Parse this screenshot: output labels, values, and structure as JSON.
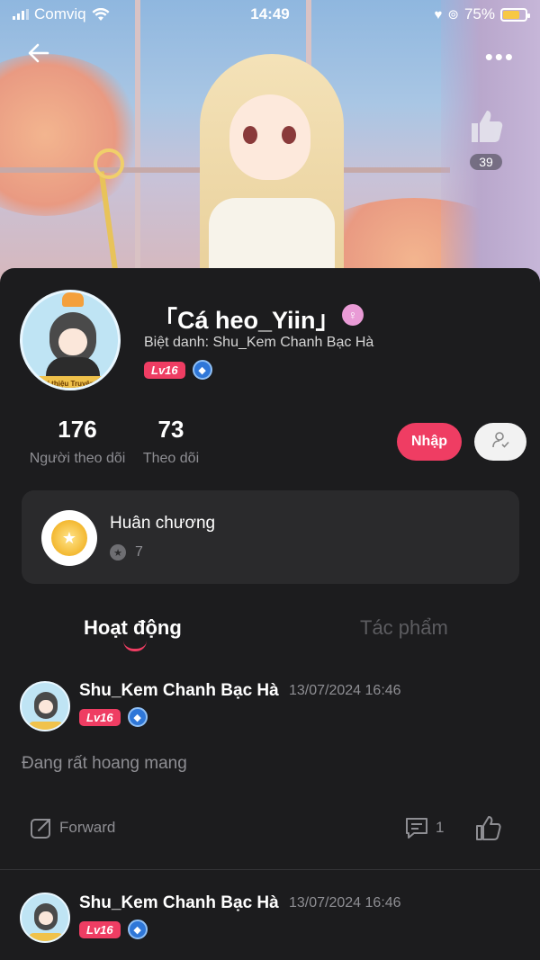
{
  "status_bar": {
    "carrier": "Comviq",
    "time": "14:49",
    "battery": "75%",
    "battery_level": 0.75
  },
  "header": {
    "like_count": "39"
  },
  "profile": {
    "name": "「Cá heo_Yiin」",
    "nickname": "Biệt danh: Shu_Kem Chanh Bạc Hà",
    "level": "Lv16",
    "avatar_caption": "Giới thiệu Truyện chat",
    "followers": {
      "count": "176",
      "label": "Người theo dõi"
    },
    "following": {
      "count": "73",
      "label": "Theo dõi"
    },
    "join_label": "Nhập"
  },
  "medal": {
    "title": "Huân chương",
    "count": "7"
  },
  "tabs": [
    {
      "label": "Hoạt động",
      "active": true
    },
    {
      "label": "Tác phẩm",
      "active": false
    }
  ],
  "posts": [
    {
      "author": "Shu_Kem Chanh Bạc Hà",
      "time": "13/07/2024 16:46",
      "level": "Lv16",
      "text": "Đang rất hoang mang",
      "forward_label": "Forward",
      "comment_count": "1"
    },
    {
      "author": "Shu_Kem Chanh Bạc Hà",
      "time": "13/07/2024 16:46",
      "level": "Lv16"
    }
  ],
  "colors": {
    "accent": "#ef3d63",
    "background": "#1c1c1e",
    "card": "#2a2a2c",
    "muted_text": "#8e8e93"
  },
  "icons": {
    "back": "arrow-left-icon",
    "more": "more-horizontal-icon",
    "like": "thumbs-up-icon",
    "gender": "female-icon",
    "diamond": "diamond-icon",
    "follow": "person-check-icon",
    "medal": "medal-icon",
    "forward": "share-icon",
    "comment": "comment-icon"
  }
}
